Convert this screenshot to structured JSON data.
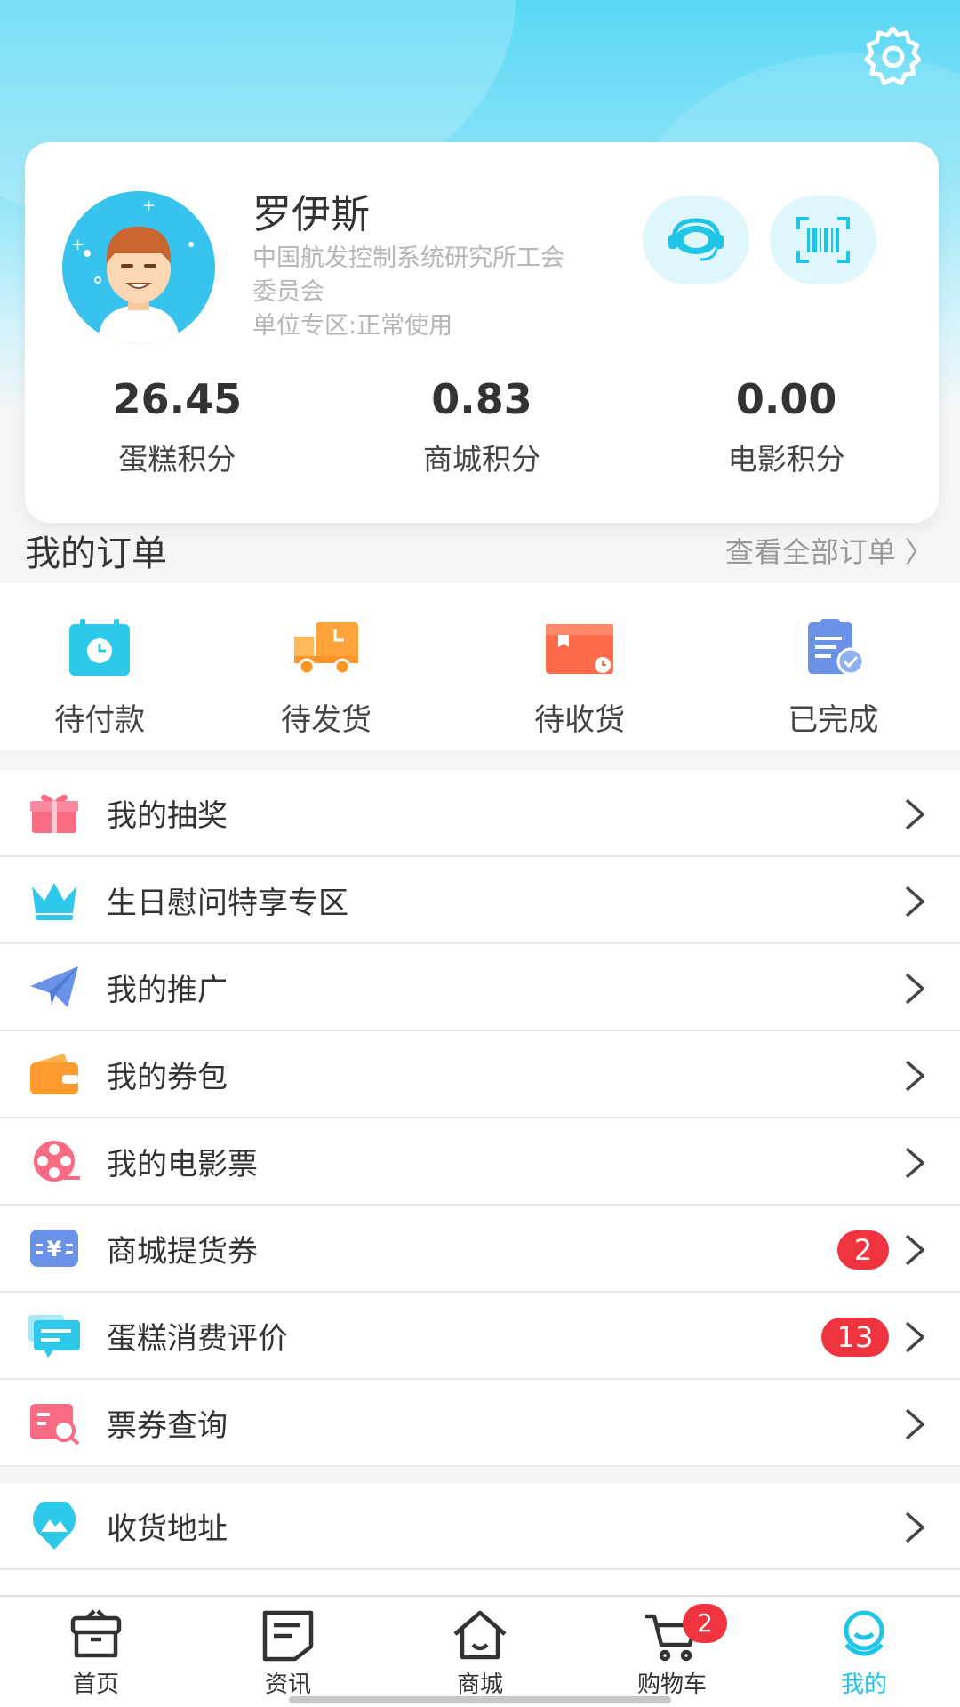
{
  "profile": {
    "name": "罗伊斯",
    "org_line1": "中国航发控制系统研究所工会",
    "org_line2": "委员会",
    "unit_status": "单位专区:正常使用"
  },
  "points": [
    {
      "value": "26.45",
      "label": "蛋糕积分"
    },
    {
      "value": "0.83",
      "label": "商城积分"
    },
    {
      "value": "0.00",
      "label": "电影积分"
    }
  ],
  "orders": {
    "title": "我的订单",
    "view_all": "查看全部订单 〉",
    "items": [
      {
        "label": "待付款",
        "icon": "pending-payment-icon"
      },
      {
        "label": "待发货",
        "icon": "truck-icon"
      },
      {
        "label": "待收货",
        "icon": "parcel-icon"
      },
      {
        "label": "已完成",
        "icon": "clipboard-check-icon"
      }
    ]
  },
  "menu": [
    {
      "label": "我的抽奖",
      "icon": "gift-icon"
    },
    {
      "label": "生日慰问特享专区",
      "icon": "crown-icon"
    },
    {
      "label": "我的推广",
      "icon": "paper-plane-icon"
    },
    {
      "label": "我的券包",
      "icon": "wallet-icon"
    },
    {
      "label": "我的电影票",
      "icon": "film-reel-icon"
    },
    {
      "label": "商城提货券",
      "icon": "ticket-icon",
      "badge": "2"
    },
    {
      "label": "蛋糕消费评价",
      "icon": "comment-icon",
      "badge": "13"
    },
    {
      "label": "票券查询",
      "icon": "search-doc-icon"
    }
  ],
  "menu2": [
    {
      "label": "收货地址",
      "icon": "location-icon"
    }
  ],
  "nav": {
    "items": [
      {
        "label": "首页",
        "icon": "home-box-icon"
      },
      {
        "label": "资讯",
        "icon": "news-icon"
      },
      {
        "label": "商城",
        "icon": "house-icon"
      },
      {
        "label": "购物车",
        "icon": "cart-icon"
      },
      {
        "label": "我的",
        "icon": "profile-icon"
      }
    ],
    "cart_count": "2",
    "active": "我的"
  },
  "colors": {
    "accent": "#1ec5e6",
    "badge": "#f0343f",
    "header_gradient_top": "#5ad8f5"
  }
}
